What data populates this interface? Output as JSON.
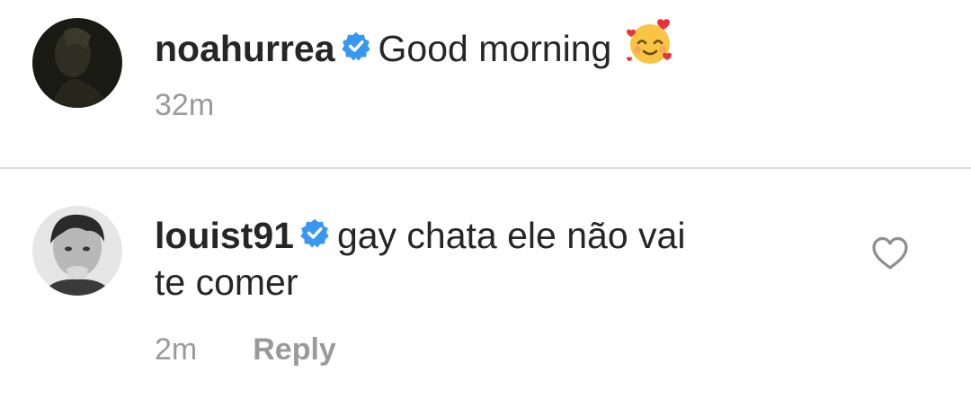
{
  "comments": [
    {
      "username": "noahurrea",
      "verified": true,
      "text": "Good morning",
      "emoji": "smiling-face-with-hearts",
      "time": "32m"
    },
    {
      "username": "louist91",
      "verified": true,
      "text_line1": "gay chata ele não vai",
      "text_line2": "te comer",
      "time": "2m",
      "reply_label": "Reply",
      "like_icon": "heart-outline-icon"
    }
  ],
  "colors": {
    "verified_blue": "#3897f0",
    "meta_gray": "#9a9a9a",
    "divider": "#dbdbdb"
  }
}
